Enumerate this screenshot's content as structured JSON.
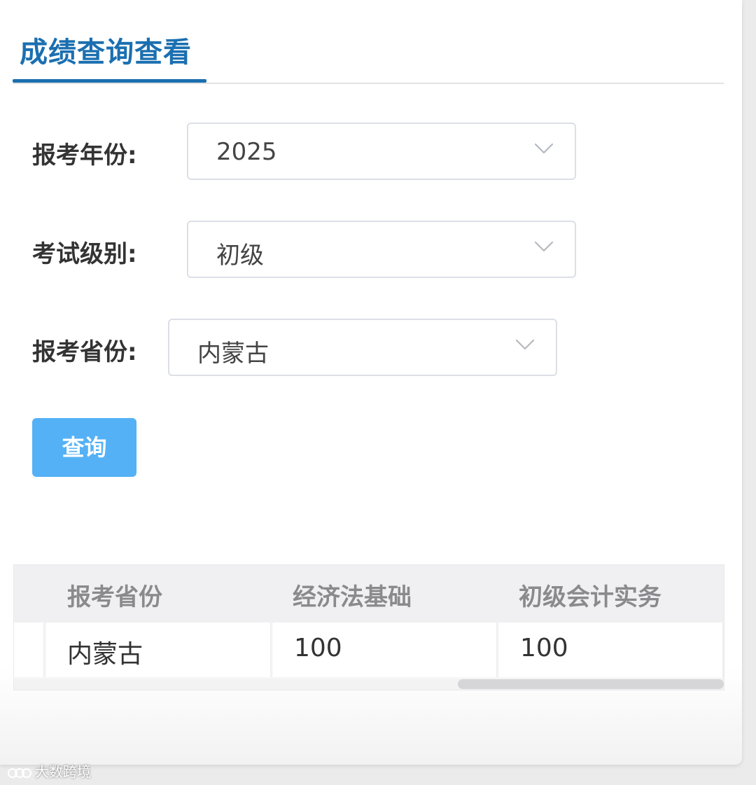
{
  "page": {
    "title": "成绩查询查看"
  },
  "form": {
    "year": {
      "label": "报考年份:",
      "value": "2025",
      "icon": "chevron-down-icon"
    },
    "level": {
      "label": "考试级别:",
      "value": "初级",
      "icon": "chevron-down-icon"
    },
    "province": {
      "label": "报考省份:",
      "value": "内蒙古",
      "icon": "chevron-down-icon"
    },
    "submit_label": "查询"
  },
  "results": {
    "columns": [
      "报考省份",
      "经济法基础",
      "初级会计实务"
    ],
    "rows": [
      [
        "内蒙古",
        "100",
        "100"
      ]
    ]
  },
  "watermark": {
    "text": "大数跨境"
  },
  "colors": {
    "accent": "#1b6fb0",
    "button": "#54b1f5",
    "header_bg": "#f0f0f2",
    "header_text": "#8a8a8e"
  }
}
